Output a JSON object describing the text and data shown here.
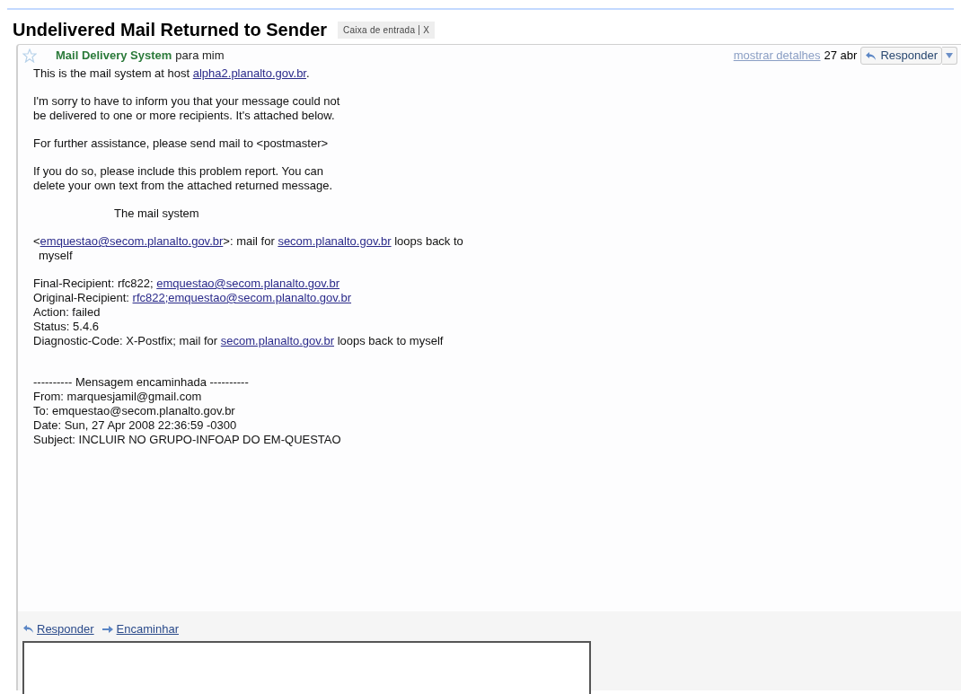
{
  "subject": "Undelivered Mail Returned to Sender",
  "label": {
    "text": "Caixa de entrada",
    "remove": "X"
  },
  "message": {
    "starred": false,
    "sender": "Mail Delivery System",
    "recipient": "para mim",
    "details_link": "mostrar detalhes",
    "date": "27 abr",
    "reply_button": "Responder"
  },
  "body": [
    {
      "lines": [
        [
          {
            "kind": "text",
            "text": "This is the mail system at host "
          },
          {
            "kind": "link",
            "text": "alpha2.planalto.gov.br"
          },
          {
            "kind": "text",
            "text": "."
          }
        ]
      ]
    },
    {
      "lines": [
        [
          {
            "kind": "text",
            "text": "I'm sorry to have to inform you that your message could not"
          }
        ],
        [
          {
            "kind": "text",
            "text": "be delivered to one or more recipients. It's attached below."
          }
        ]
      ]
    },
    {
      "lines": [
        [
          {
            "kind": "text",
            "text": "For further assistance, please send mail to <postmaster>"
          }
        ]
      ]
    },
    {
      "lines": [
        [
          {
            "kind": "text",
            "text": "If you do so, please include this problem report. You can"
          }
        ],
        [
          {
            "kind": "text",
            "text": "delete your own text from the attached returned message."
          }
        ]
      ]
    },
    {
      "kind": "signature",
      "lines": [
        [
          {
            "kind": "text",
            "text": "The mail system"
          }
        ]
      ]
    },
    {
      "lines": [
        [
          {
            "kind": "text",
            "text": "<"
          },
          {
            "kind": "link",
            "text": "emquestao@secom.planalto.gov.br"
          },
          {
            "kind": "text",
            "text": ">: mail for "
          },
          {
            "kind": "link",
            "text": "secom.planalto.gov.br"
          },
          {
            "kind": "text",
            "text": " loops back to"
          }
        ],
        [
          {
            "kind": "wrapped",
            "text": "myself"
          }
        ]
      ]
    },
    {
      "lines": [
        [
          {
            "kind": "text",
            "text": "Final-Recipient: rfc822; "
          },
          {
            "kind": "link",
            "text": "emquestao@secom.planalto.gov.br"
          }
        ],
        [
          {
            "kind": "text",
            "text": "Original-Recipient: "
          },
          {
            "kind": "link",
            "text": "rfc822;emquestao@secom.planalto.gov.br"
          }
        ],
        [
          {
            "kind": "text",
            "text": "Action: failed"
          }
        ],
        [
          {
            "kind": "text",
            "text": "Status: 5.4.6"
          }
        ],
        [
          {
            "kind": "text",
            "text": "Diagnostic-Code: X-Postfix; mail for "
          },
          {
            "kind": "link",
            "text": "secom.planalto.gov.br"
          },
          {
            "kind": "text",
            "text": " loops back to myself"
          }
        ]
      ]
    },
    {
      "kind": "forwarded",
      "lines": [
        [
          {
            "kind": "text",
            "text": "---------- Mensagem encaminhada ----------"
          }
        ],
        [
          {
            "kind": "text",
            "text": "From: marquesjamil@gmail.com"
          }
        ],
        [
          {
            "kind": "text",
            "text": "To: emquestao@secom.planalto.gov.br"
          }
        ],
        [
          {
            "kind": "text",
            "text": "Date: Sun, 27 Apr 2008 22:36:59 -0300"
          }
        ],
        [
          {
            "kind": "text",
            "text": "Subject: INCLUIR NO GRUPO-INFOAP DO EM-QUESTAO"
          }
        ]
      ]
    }
  ],
  "actions": [
    {
      "kind": "reply",
      "label": "Responder"
    },
    {
      "kind": "forward",
      "label": "Encaminhar"
    }
  ]
}
